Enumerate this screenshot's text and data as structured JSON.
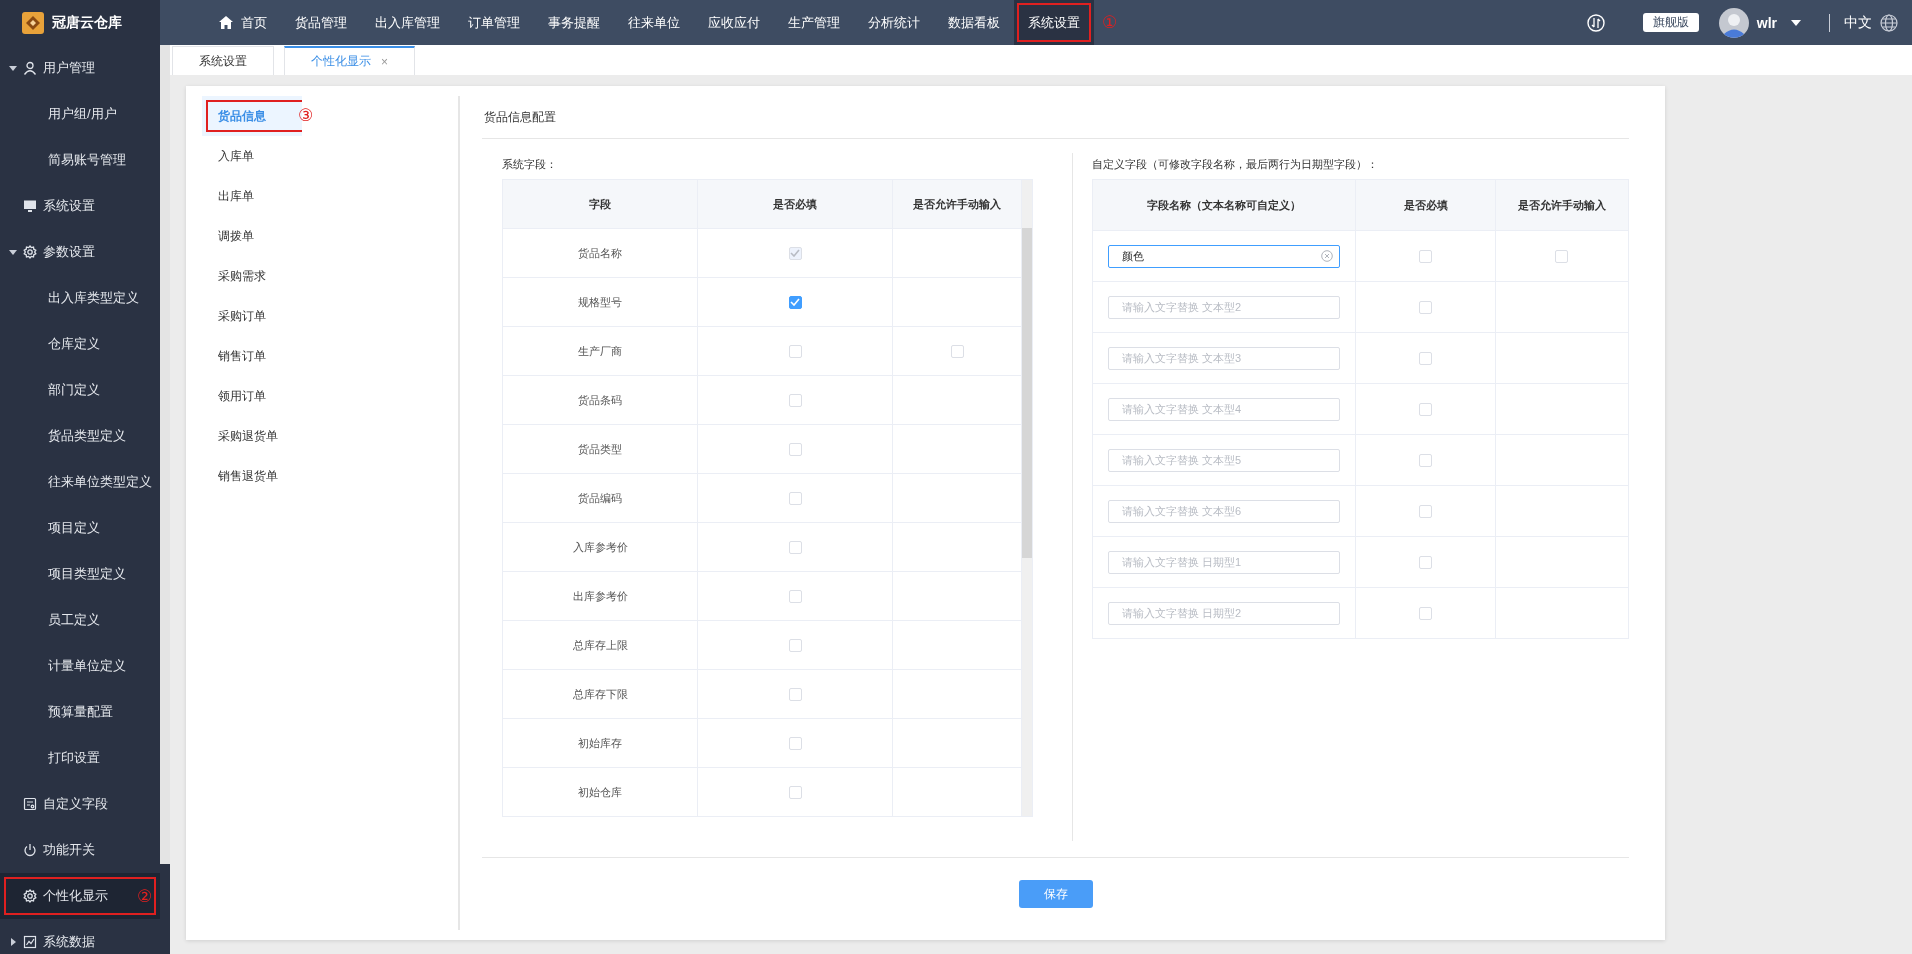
{
  "brand": {
    "name": "冠唐云仓库"
  },
  "top_nav": [
    {
      "label": "首页",
      "kind": "home",
      "selected": false
    },
    {
      "label": "货品管理",
      "selected": false
    },
    {
      "label": "出入库管理",
      "selected": false
    },
    {
      "label": "订单管理",
      "selected": false
    },
    {
      "label": "事务提醒",
      "selected": false
    },
    {
      "label": "往来单位",
      "selected": false
    },
    {
      "label": "应收应付",
      "selected": false
    },
    {
      "label": "生产管理",
      "selected": false
    },
    {
      "label": "分析统计",
      "selected": false
    },
    {
      "label": "数据看板",
      "selected": false
    },
    {
      "label": "系统设置",
      "selected": true,
      "marker": "①"
    }
  ],
  "top_right": {
    "edition": "旗舰版",
    "user": "wlr",
    "language": "中文"
  },
  "sidebar": [
    {
      "label": "用户管理",
      "kind": "user",
      "expanded": true,
      "selected": false,
      "children": [
        {
          "label": "用户组/用户",
          "selected": false
        },
        {
          "label": "简易账号管理",
          "selected": false
        }
      ]
    },
    {
      "label": "系统设置",
      "kind": "monitor",
      "selected": false
    },
    {
      "label": "参数设置",
      "kind": "gear",
      "expanded": true,
      "selected": false,
      "children": [
        {
          "label": "出入库类型定义",
          "selected": false
        },
        {
          "label": "仓库定义",
          "selected": false
        },
        {
          "label": "部门定义",
          "selected": false
        },
        {
          "label": "货品类型定义",
          "selected": false
        },
        {
          "label": "往来单位类型定义",
          "selected": false
        },
        {
          "label": "项目定义",
          "selected": false
        },
        {
          "label": "项目类型定义",
          "selected": false
        },
        {
          "label": "员工定义",
          "selected": false
        },
        {
          "label": "计量单位定义",
          "selected": false
        },
        {
          "label": "预算量配置",
          "selected": false
        },
        {
          "label": "打印设置",
          "selected": false
        }
      ]
    },
    {
      "label": "自定义字段",
      "kind": "form",
      "selected": false
    },
    {
      "label": "功能开关",
      "kind": "power",
      "selected": false
    },
    {
      "label": "个性化显示",
      "kind": "gear",
      "selected": true,
      "marker": "②"
    },
    {
      "label": "系统数据",
      "kind": "chart",
      "expanded": false,
      "selected": false
    }
  ],
  "tabs": [
    {
      "label": "系统设置",
      "selected": false
    },
    {
      "label": "个性化显示",
      "selected": true,
      "close": "×"
    }
  ],
  "doc_menu": [
    {
      "label": "货品信息",
      "selected": true,
      "marker": "③"
    },
    {
      "label": "入库单",
      "selected": false
    },
    {
      "label": "出库单",
      "selected": false
    },
    {
      "label": "调拨单",
      "selected": false
    },
    {
      "label": "采购需求",
      "selected": false
    },
    {
      "label": "采购订单",
      "selected": false
    },
    {
      "label": "销售订单",
      "selected": false
    },
    {
      "label": "领用订单",
      "selected": false
    },
    {
      "label": "采购退货单",
      "selected": false
    },
    {
      "label": "销售退货单",
      "selected": false
    }
  ],
  "section_title": "货品信息配置",
  "system_fields": {
    "label": "系统字段：",
    "columns": [
      "字段",
      "是否必填",
      "是否允许手动输入"
    ],
    "rows": [
      {
        "name": "货品名称",
        "required_checked": true,
        "required_disabled": true
      },
      {
        "name": "规格型号",
        "required_checked": true,
        "required_disabled": false
      },
      {
        "name": "生产厂商",
        "required_checked": false,
        "required_disabled": false,
        "manual": {
          "checked": false
        }
      },
      {
        "name": "货品条码",
        "required_checked": false,
        "required_disabled": false
      },
      {
        "name": "货品类型",
        "required_checked": false,
        "required_disabled": false
      },
      {
        "name": "货品编码",
        "required_checked": false,
        "required_disabled": false
      },
      {
        "name": "入库参考价",
        "required_checked": false,
        "required_disabled": false
      },
      {
        "name": "出库参考价",
        "required_checked": false,
        "required_disabled": false
      },
      {
        "name": "总库存上限",
        "required_checked": false,
        "required_disabled": false
      },
      {
        "name": "总库存下限",
        "required_checked": false,
        "required_disabled": false
      },
      {
        "name": "初始库存",
        "required_checked": false,
        "required_disabled": false
      },
      {
        "name": "初始仓库",
        "required_checked": false,
        "required_disabled": false
      }
    ]
  },
  "custom_fields": {
    "label": "自定义字段（可修改字段名称，最后两行为日期型字段）：",
    "columns": [
      "字段名称（文本名称可自定义）",
      "是否必填",
      "是否允许手动输入"
    ],
    "rows": [
      {
        "value": "颜色",
        "focused": true,
        "required_checked": false,
        "manual": {
          "checked": false
        }
      },
      {
        "placeholder": "请输入文字替换 文本型2",
        "focused": false,
        "required_checked": false
      },
      {
        "placeholder": "请输入文字替换 文本型3",
        "focused": false,
        "required_checked": false
      },
      {
        "placeholder": "请输入文字替换 文本型4",
        "focused": false,
        "required_checked": false
      },
      {
        "placeholder": "请输入文字替换 文本型5",
        "focused": false,
        "required_checked": false
      },
      {
        "placeholder": "请输入文字替换 文本型6",
        "focused": false,
        "required_checked": false
      },
      {
        "placeholder": "请输入文字替换 日期型1",
        "focused": false,
        "required_checked": false
      },
      {
        "placeholder": "请输入文字替换 日期型2",
        "focused": false,
        "required_checked": false
      }
    ]
  },
  "save_button": "保存"
}
